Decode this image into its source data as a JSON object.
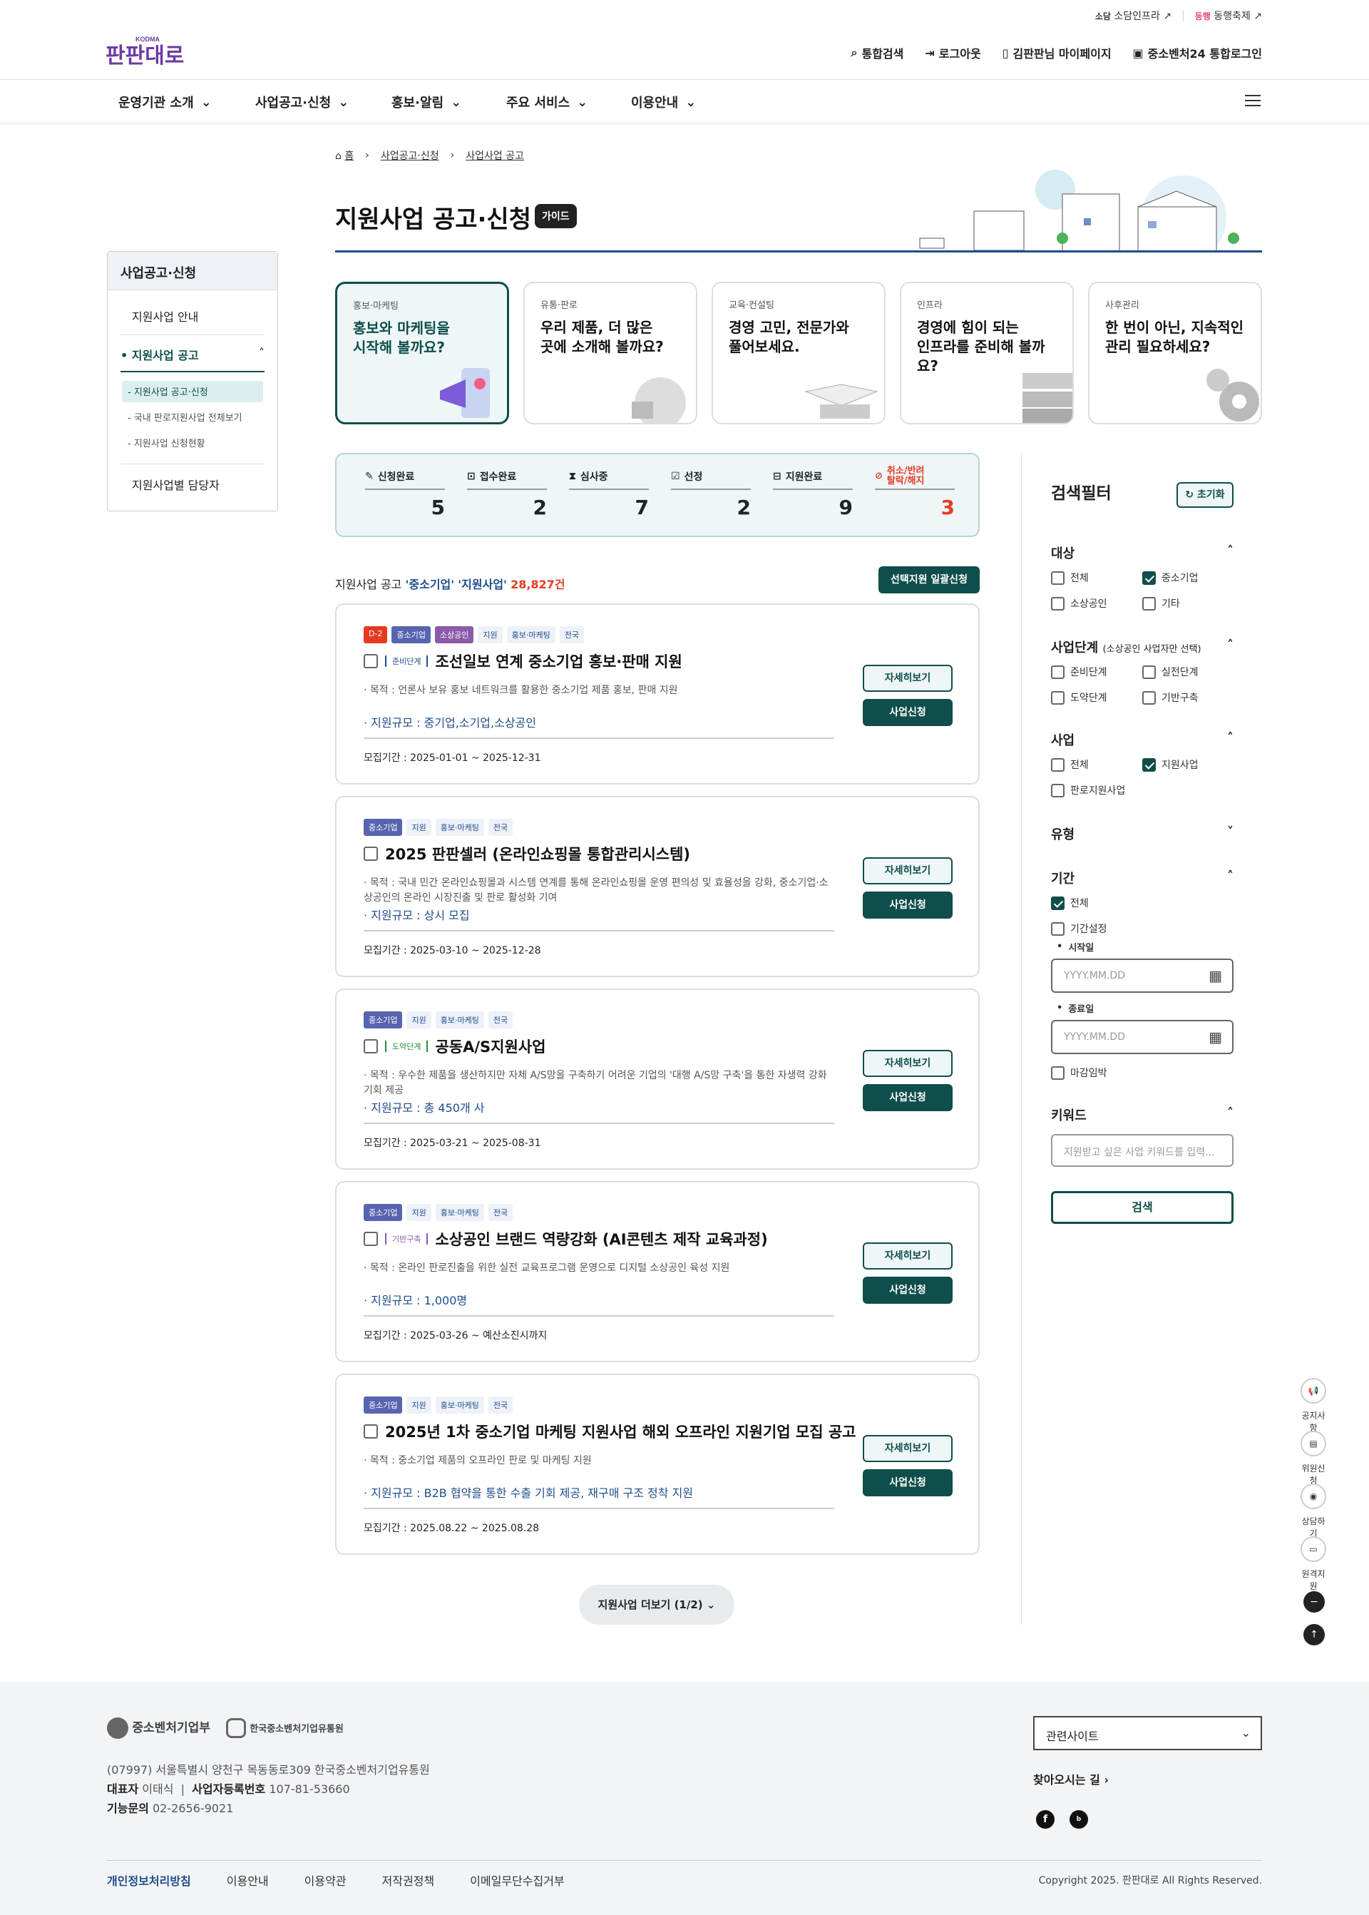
{
  "util": {
    "items": [
      "소담인프라",
      "동행축제"
    ]
  },
  "header": {
    "logo_text": "판판대로",
    "links": [
      "통합검색",
      "로그아웃",
      "김판판님 마이페이지",
      "중소벤처24 통합로그인"
    ]
  },
  "nav": {
    "items": [
      "운영기관 소개",
      "사업공고·신청",
      "홍보·알림",
      "주요 서비스",
      "이용안내"
    ]
  },
  "breadcrumb": [
    "홈",
    "사업공고·신청",
    "사업사업 공고"
  ],
  "page": {
    "title": "지원사업 공고·신청",
    "guide": "가이드"
  },
  "sidebar": {
    "heading": "사업공고·신청",
    "items": [
      "지원사업 안내",
      "지원사업 공고",
      "지원사업별 담당자"
    ],
    "subitems": [
      "- 지원사업 공고·신청",
      "- 국내 판로지원사업 전체보기",
      "- 지원사업 신청현황"
    ]
  },
  "cards": [
    {
      "cat": "홍보·마케팅",
      "title1": "홍보와 마케팅을",
      "title2": "시작해 볼까요?"
    },
    {
      "cat": "유통·판로",
      "title1": "우리 제품, 더 많은",
      "title2": "곳에 소개해 볼까요?"
    },
    {
      "cat": "교육·컨설팅",
      "title1": "경영 고민, 전문가와",
      "title2": "풀어보세요."
    },
    {
      "cat": "인프라",
      "title1": "경영에 힘이 되는",
      "title2": "인프라를 준비해 볼까요?"
    },
    {
      "cat": "사후관리",
      "title1": "한 번이 아닌, 지속적인",
      "title2": "관리 필요하세요?"
    }
  ],
  "stats": [
    {
      "label": "신청완료",
      "value": "5"
    },
    {
      "label": "접수완료",
      "value": "2"
    },
    {
      "label": "심사중",
      "value": "7"
    },
    {
      "label": "선정",
      "value": "2"
    },
    {
      "label": "지원완료",
      "value": "9"
    },
    {
      "label1": "취소/반려",
      "label2": "탈락/해지",
      "value": "3"
    }
  ],
  "list": {
    "prefix": "지원사업 공고",
    "q1": "'중소기업'",
    "q2": "'지원사업'",
    "count": "28,827건",
    "bulk": "선택지원 일괄신청"
  },
  "items": [
    {
      "tags": [
        "D-2",
        "중소기업",
        "소상공인",
        "지원",
        "홍보·마케팅",
        "전국"
      ],
      "stage": "준비단계",
      "title": "조선일보 연계 중소기업 홍보·판매 지원",
      "desc": "· 목적 : 언론사 보유 홍보 네트워크를 활용한 중소기업 제품 홍보, 판매 지원",
      "scale": "· 지원규모 : 중기업,소기업,소상공인",
      "period": "모집기간 : 2025-01-01 ~ 2025-12-31"
    },
    {
      "tags": [
        "중소기업",
        "지원",
        "홍보·마케팅",
        "전국"
      ],
      "stage": "",
      "title": "2025 판판셀러 (온라인쇼핑몰 통합관리시스템)",
      "desc": "· 목적 : 국내 민간 온라인쇼핑몰과 시스템 연계를 통해 온라인쇼핑몰 운영 편의성 및 효율성을 강화, 중소기업·소상공인의 온라인 시장진출 및 판로 활성화 기여",
      "scale": "· 지원규모 : 상시 모집",
      "period": "모집기간 : 2025-03-10 ~ 2025-12-28"
    },
    {
      "tags": [
        "중소기업",
        "지원",
        "홍보·마케팅",
        "전국"
      ],
      "stage": "도약단계",
      "title": "공동A/S지원사업",
      "desc": "· 목적 : 우수한 제품을 생산하지만 자체 A/S망을 구축하기 어려운 기업의 '대행 A/S망 구축'을 통한 자생력 강화 기회 제공",
      "scale": "· 지원규모 : 총 450개 사",
      "period": "모집기간 : 2025-03-21 ~ 2025-08-31"
    },
    {
      "tags": [
        "중소기업",
        "지원",
        "홍보·마케팅",
        "전국"
      ],
      "stage": "기반구축",
      "title": "소상공인 브랜드 역량강화 (AI콘텐츠 제작 교육과정)",
      "desc": "· 목적 : 온라인 판로진출을 위한 실전 교육프로그램 운영으로 디지털 소상공인 육성 지원",
      "scale": "· 지원규모 : 1,000명",
      "period": "모집기간 : 2025-03-26 ~ 예산소진시까지"
    },
    {
      "tags": [
        "중소기업",
        "지원",
        "홍보·마케팅",
        "전국"
      ],
      "stage": "",
      "title": "2025년 1차 중소기업 마케팅 지원사업 해외 오프라인 지원기업 모집 공고",
      "desc": "· 목적 : 중소기업 제품의 오프라인 판로 및 마케팅 지원",
      "scale": "· 지원규모 : B2B 협약을 통한 수출 기회 제공, 재구매 구조 정착 지원",
      "period": "모집기간 : 2025.08.22 ~ 2025.08.28"
    }
  ],
  "buttons": {
    "detail": "자세히보기",
    "apply": "사업신청"
  },
  "more": "지원사업 더보기 (1/2)",
  "filter": {
    "title": "검색필터",
    "reset": "초기화",
    "target": {
      "h": "대상",
      "opts": [
        "전체",
        "중소기업",
        "소상공인",
        "기타"
      ]
    },
    "stage": {
      "h": "사업단계",
      "note": "(소상공인 사업자만 선택)",
      "opts": [
        "준비단계",
        "실전단계",
        "도약단계",
        "기반구축"
      ]
    },
    "biz": {
      "h": "사업",
      "opts": [
        "전체",
        "지원사업",
        "판로지원사업"
      ]
    },
    "type": {
      "h": "유형"
    },
    "period": {
      "h": "기간",
      "opts": [
        "전체",
        "기간설정"
      ],
      "start": "시작일",
      "end": "종료일",
      "ph": "YYYY.MM.DD",
      "closing": "마감임박"
    },
    "keyword": {
      "h": "키워드",
      "ph": "지원받고 싶은 사업 키워드를 입력..."
    },
    "search": "검색"
  },
  "quick": [
    "공지사항",
    "위원신청",
    "상담하기",
    "원격지원"
  ],
  "footer": {
    "org1": "중소벤처기업부",
    "org2": "한국중소벤처기업유통원",
    "address": "(07997) 서울특별시 양천구 목동동로309 한국중소벤처기업유통원",
    "ceo_label": "대표자",
    "ceo": "이태식",
    "reg_label": "사업자등록번호",
    "reg": "107-81-53660",
    "tel_label": "기능문의",
    "tel": "02-2656-9021",
    "related": "관련사이트",
    "directions": "찾아오시는 길 ›",
    "links": [
      "개인정보처리방침",
      "이용안내",
      "이용약관",
      "저작권정책",
      "이메일무단수집거부"
    ],
    "copyright": "Copyright 2025. 판판대로 All Rights Reserved."
  },
  "colors": {
    "primary": "#0f4e4a",
    "navy": "#1e4d8c",
    "red": "#e53b20"
  }
}
